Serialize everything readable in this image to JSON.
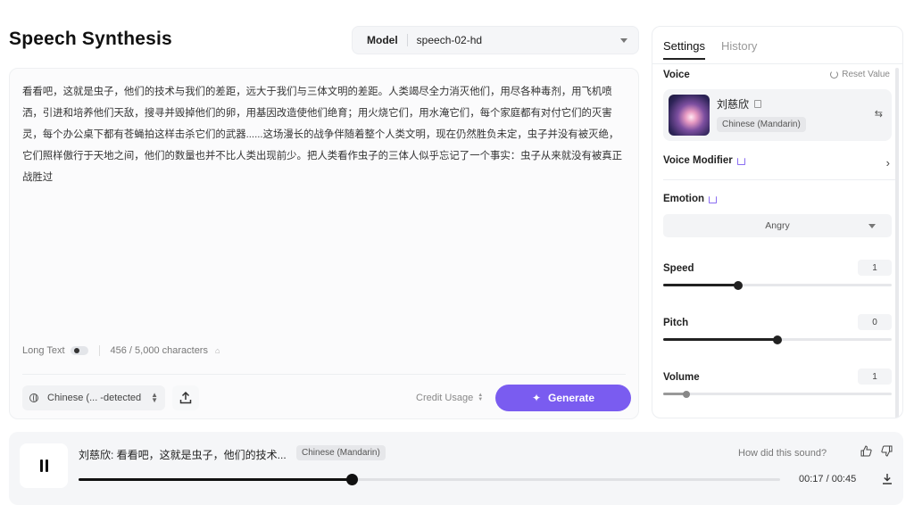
{
  "page": {
    "title": "Speech Synthesis"
  },
  "model": {
    "label": "Model",
    "value": "speech-02-hd"
  },
  "editor": {
    "text": "看看吧，这就是虫子，他们的技术与我们的差距，远大于我们与三体文明的差距。人类竭尽全力消灭他们，用尽各种毒剂，用飞机喷洒，引进和培养他们天敌，搜寻并毁掉他们的卵，用基因改造使他们绝育；用火烧它们，用水淹它们，每个家庭都有对付它们的灭害灵，每个办公桌下都有苍蝇拍这样击杀它们的武器......这场漫长的战争伴随着整个人类文明，现在仍然胜负未定，虫子并没有被灭绝，它们照样傲行于天地之间，他们的数量也并不比人类出现前少。把人类看作虫子的三体人似乎忘记了一个事实：虫子从来就没有被真正战胜过",
    "long_text_label": "Long Text",
    "long_text_on": false,
    "char_count": "456 / 5,000 characters",
    "language": "Chinese (... -detected",
    "credit_label": "Credit Usage",
    "generate_label": "Generate"
  },
  "settings": {
    "tabs": [
      {
        "label": "Settings",
        "active": true
      },
      {
        "label": "History",
        "active": false
      }
    ],
    "voice_label": "Voice",
    "reset_label": "Reset Value",
    "voice_name": "刘慈欣",
    "voice_language": "Chinese (Mandarin)",
    "voice_modifier_label": "Voice Modifier",
    "emotion_label": "Emotion",
    "emotion_value": "Angry",
    "speed": {
      "label": "Speed",
      "value": "1",
      "fraction": 0.33
    },
    "pitch": {
      "label": "Pitch",
      "value": "0",
      "fraction": 0.5
    },
    "volume": {
      "label": "Volume",
      "value": "1",
      "fraction": 0.1
    }
  },
  "player": {
    "track_title": "刘慈欣: 看看吧，这就是虫子，他们的技术...",
    "track_language": "Chinese (Mandarin)",
    "feedback_prompt": "How did this sound?",
    "elapsed": "00:17",
    "duration": "00:45",
    "time_display": "00:17 / 00:45",
    "progress_fraction": 0.39
  },
  "colors": {
    "accent": "#7a5cf0",
    "dark": "#111111",
    "panel": "#f5f6f8"
  },
  "icons": {
    "language": "globe-icon",
    "upload": "upload-icon",
    "generate": "sparkle-icon",
    "reset": "refresh-icon",
    "copy": "copy-icon",
    "swap": "swap-icon",
    "premium": "crown-icon",
    "pause": "pause-icon",
    "like": "thumbs-up-icon",
    "dislike": "thumbs-down-icon",
    "download": "download-icon"
  }
}
